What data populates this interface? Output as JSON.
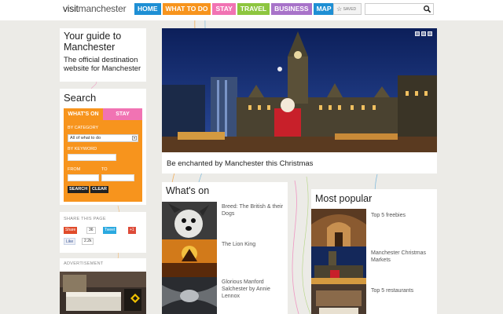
{
  "header": {
    "logo_a": "visit",
    "logo_b": "manchester",
    "nav": [
      {
        "label": "HOME",
        "color": "#1e8fd4"
      },
      {
        "label": "WHAT TO DO",
        "color": "#f7941d"
      },
      {
        "label": "STAY",
        "color": "#f173b3"
      },
      {
        "label": "TRAVEL",
        "color": "#8dc63f"
      },
      {
        "label": "BUSINESS",
        "color": "#a873c9"
      },
      {
        "label": "MAP",
        "color": "#1e8fd4"
      }
    ],
    "saved_label": "SAVED",
    "search_placeholder": ""
  },
  "guide": {
    "title": "Your guide to Manchester",
    "subtitle": "The official destination website for Manchester"
  },
  "search": {
    "title": "Search",
    "tab_whats_on": "WHAT'S ON",
    "tab_stay": "STAY",
    "by_category": "BY CATEGORY",
    "category_value": "All of what to do",
    "by_keyword": "BY KEYWORD",
    "from": "FROM",
    "to": "TO",
    "search_btn": "SEARCH",
    "clear_btn": "CLEAR"
  },
  "share": {
    "label": "SHARE THIS PAGE",
    "share_btn": "Share",
    "share_count": "36",
    "tweet_btn": "Tweet",
    "tweet_count": "19",
    "gplus_btn": "+1",
    "like_btn": "Like",
    "like_count": "2.2k"
  },
  "ad": {
    "label": "ADVERTISEMENT"
  },
  "hero": {
    "caption": "Be enchanted by Manchester this Christmas"
  },
  "whats_on": {
    "title": "What's on",
    "items": [
      {
        "title": "Breed: The British & their Dogs"
      },
      {
        "title": "The Lion King"
      },
      {
        "title": "Glorious Manford Salchester by Annie Lennox"
      }
    ]
  },
  "popular": {
    "title": "Most popular",
    "items": [
      {
        "title": "Top 5 freebies"
      },
      {
        "title": "Manchester Christmas Markets"
      },
      {
        "title": "Top 5 restaurants"
      }
    ]
  },
  "colors": {
    "orange": "#f7941d",
    "pink": "#f173b3",
    "blue": "#1e8fd4"
  }
}
